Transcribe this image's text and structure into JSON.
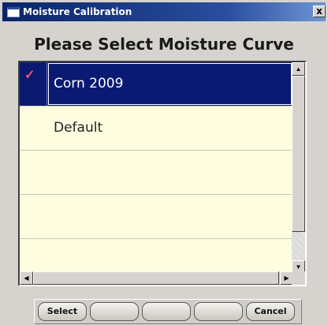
{
  "window": {
    "title": "Moisture Calibration",
    "close_label": "x"
  },
  "heading": "Please Select Moisture Curve",
  "list": {
    "rows": [
      {
        "label": "Corn 2009",
        "selected": true,
        "checked": true
      },
      {
        "label": "Default",
        "selected": false,
        "checked": false
      },
      {
        "label": "",
        "selected": false,
        "checked": false
      },
      {
        "label": "",
        "selected": false,
        "checked": false
      },
      {
        "label": "",
        "selected": false,
        "checked": false
      }
    ],
    "check_glyph": "✓"
  },
  "buttons": [
    {
      "label": "Select"
    },
    {
      "label": ""
    },
    {
      "label": ""
    },
    {
      "label": ""
    },
    {
      "label": "Cancel"
    }
  ],
  "colors": {
    "selection": "#0a1a72",
    "list_background": "#fffde0",
    "title_bar": "#0a246a"
  }
}
